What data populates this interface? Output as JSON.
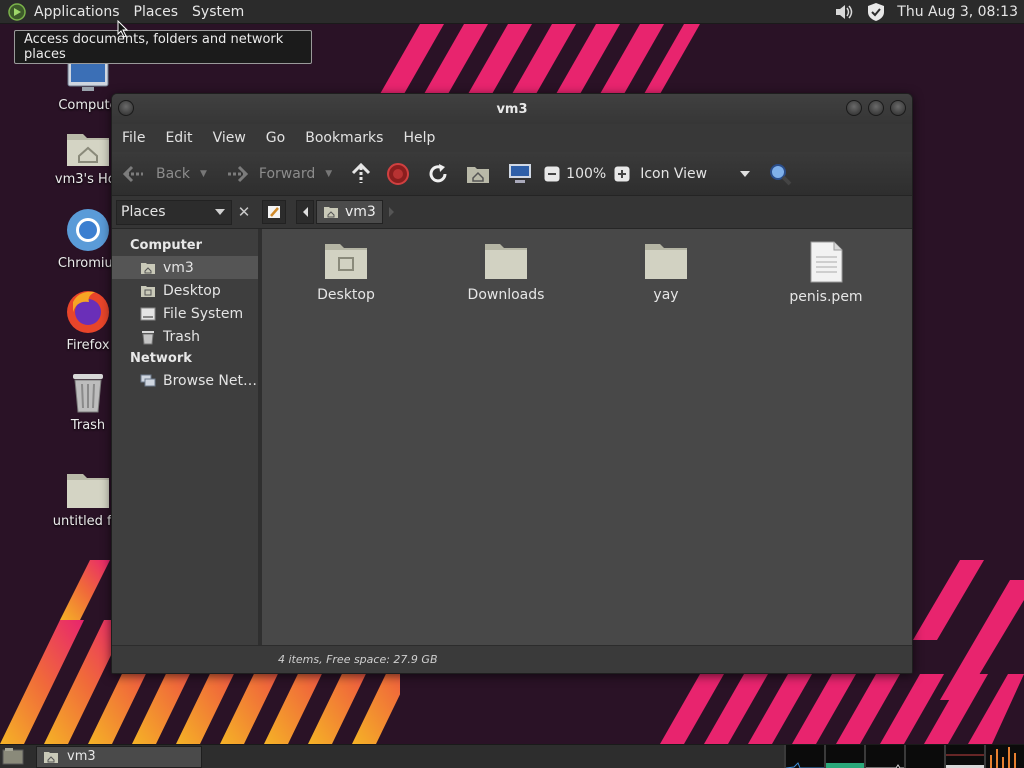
{
  "top_panel": {
    "menus": [
      "Applications",
      "Places",
      "System"
    ],
    "clock": "Thu Aug  3, 08:13",
    "icons": [
      "volume-icon",
      "shield-icon"
    ]
  },
  "tooltip": {
    "text": "Access documents, folders and network places"
  },
  "desktop": {
    "icons": [
      {
        "label": "Compute",
        "icon": "computer-icon"
      },
      {
        "label": "vm3's Hor",
        "icon": "home-folder-icon"
      },
      {
        "label": "Chromiur",
        "icon": "chromium-icon"
      },
      {
        "label": "Firefox",
        "icon": "firefox-icon"
      },
      {
        "label": "Trash",
        "icon": "trash-icon"
      },
      {
        "label": "untitled fol",
        "icon": "folder-icon"
      }
    ]
  },
  "window": {
    "title": "vm3",
    "menu": [
      "File",
      "Edit",
      "View",
      "Go",
      "Bookmarks",
      "Help"
    ],
    "toolbar": {
      "back": "Back",
      "forward": "Forward",
      "zoom": "100%",
      "view_mode": "Icon View"
    },
    "sidebar_selector": "Places",
    "breadcrumb": {
      "current": "vm3"
    },
    "sidebar": {
      "sections": [
        {
          "heading": "Computer",
          "items": [
            {
              "label": "vm3",
              "icon": "home-icon",
              "selected": true
            },
            {
              "label": "Desktop",
              "icon": "desktop-icon",
              "selected": false
            },
            {
              "label": "File System",
              "icon": "drive-icon",
              "selected": false
            },
            {
              "label": "Trash",
              "icon": "trash-icon",
              "selected": false
            }
          ]
        },
        {
          "heading": "Network",
          "items": [
            {
              "label": "Browse Net…",
              "icon": "network-icon",
              "selected": false
            }
          ]
        }
      ]
    },
    "files": [
      {
        "name": "Desktop",
        "icon": "desktop-folder-icon"
      },
      {
        "name": "Downloads",
        "icon": "folder-icon"
      },
      {
        "name": "yay",
        "icon": "folder-icon"
      },
      {
        "name": "penis.pem",
        "icon": "text-file-icon"
      }
    ],
    "status": "4 items, Free space: 27.9 GB"
  },
  "bottom_panel": {
    "task": "vm3"
  },
  "colors": {
    "wallpaper_bg": "#2a1226",
    "stripe_pink": "#e8246e",
    "stripe_orange": "#f28a2a"
  }
}
